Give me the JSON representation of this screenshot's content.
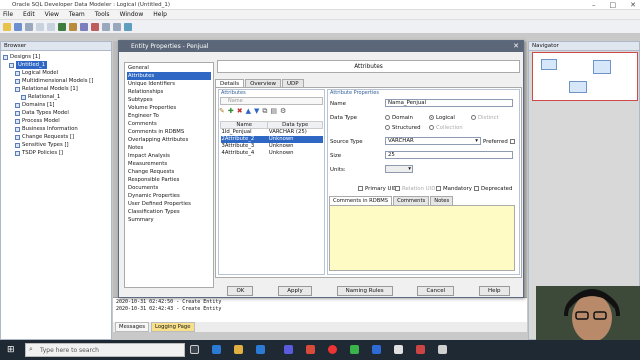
{
  "window": {
    "title": "Oracle SQL Developer Data Modeler : Logical (Untitled_1)"
  },
  "menu": [
    "File",
    "Edit",
    "View",
    "Team",
    "Tools",
    "Window",
    "Help"
  ],
  "browser": {
    "title": "Browser",
    "tree": [
      {
        "label": "Designs [1]",
        "level": 0
      },
      {
        "label": "Untitled_1",
        "level": 1,
        "selected": true
      },
      {
        "label": "Logical Model",
        "level": 2
      },
      {
        "label": "Multidimensional Models []",
        "level": 2
      },
      {
        "label": "Relational Models [1]",
        "level": 2
      },
      {
        "label": "Relational_1",
        "level": 3
      },
      {
        "label": "Domains [1]",
        "level": 2
      },
      {
        "label": "Data Types Model",
        "level": 2
      },
      {
        "label": "Process Model",
        "level": 2
      },
      {
        "label": "Business Information",
        "level": 2
      },
      {
        "label": "Change Requests []",
        "level": 2
      },
      {
        "label": "Sensitive Types []",
        "level": 2
      },
      {
        "label": "TSDP Policies []",
        "level": 2
      }
    ]
  },
  "navigator": {
    "title": "Navigator"
  },
  "log": {
    "lines": [
      "2020-10-31 02:42:50 - Create Entity",
      "2020-10-31 02:42:43 - Create Entity"
    ],
    "tabs": [
      {
        "label": "Messages",
        "active": false
      },
      {
        "label": "Logging Page",
        "active": true
      }
    ]
  },
  "dialog": {
    "title": "Entity Properties - Penjual",
    "heading": "Attributes",
    "categories": [
      "General",
      "Attributes",
      "Unique Identifiers",
      "Relationships",
      "Subtypes",
      "Volume Properties",
      "Engineer To",
      "Comments",
      "Comments in RDBMS",
      "Overlapping Attributes",
      "Notes",
      "Impact Analysis",
      "Measurements",
      "Change Requests",
      "Responsible Parties",
      "Documents",
      "Dynamic Properties",
      "User Defined Properties",
      "Classification Types",
      "Summary"
    ],
    "active_category": "Attributes",
    "tabs": [
      {
        "label": "Details",
        "active": true
      },
      {
        "label": "Overview",
        "active": false
      },
      {
        "label": "UDP",
        "active": false
      }
    ],
    "attributes_group": "Attributes",
    "filter_placeholder": "Name",
    "table": {
      "headers": [
        "Name",
        "Data type"
      ],
      "rows": [
        {
          "name": "1Id_Penjual",
          "type": "VARCHAR (25)",
          "selected": false
        },
        {
          "name": "2Attribute_2",
          "type": "Unknown",
          "selected": true
        },
        {
          "name": "3Attribute_3",
          "type": "Unknown",
          "selected": false
        },
        {
          "name": "4Attribute_4",
          "type": "Unknown",
          "selected": false
        }
      ]
    },
    "props": {
      "group": "Attribute Properties",
      "name_label": "Name",
      "name_value": "Nama_Penjual",
      "datatype_label": "Data Type",
      "domain": "Domain",
      "logical": "Logical",
      "distinct": "Distinct",
      "structured": "Structured",
      "collection": "Collection",
      "source_type_label": "Source Type",
      "source_type_value": "VARCHAR",
      "preferred": "Preferred",
      "size_label": "Size",
      "size_value": "25",
      "units_label": "Units:",
      "primary_uid": "Primary UID",
      "relation_uid": "Relation UID",
      "mandatory": "Mandatory",
      "deprecated": "Deprecated"
    },
    "comment_tabs": [
      {
        "label": "Comments in RDBMS",
        "active": true
      },
      {
        "label": "Comments",
        "active": false
      },
      {
        "label": "Notes",
        "active": false
      }
    ],
    "buttons": [
      "OK",
      "Apply",
      "Naming Rules",
      "Cancel",
      "Help"
    ]
  },
  "taskbar": {
    "search_placeholder": "Type here to search"
  }
}
